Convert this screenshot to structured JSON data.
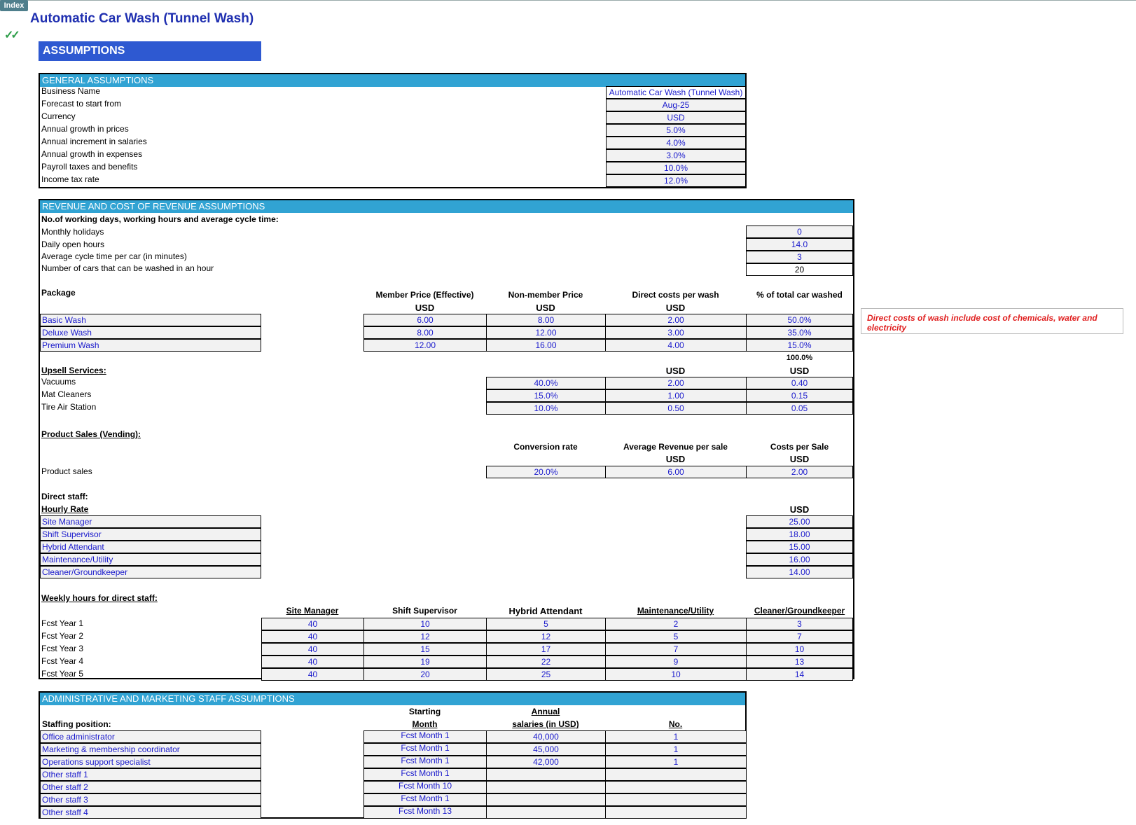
{
  "index_button": "Index",
  "title": "Automatic Car Wash (Tunnel Wash)",
  "assumptions_label": "ASSUMPTIONS",
  "general": {
    "header": "GENERAL ASSUMPTIONS",
    "rows": [
      {
        "label": "Business Name",
        "value": "Automatic Car Wash (Tunnel Wash)"
      },
      {
        "label": "Forecast to start from",
        "value": "Aug-25"
      },
      {
        "label": "Currency",
        "value": "USD"
      },
      {
        "label": "Annual growth in prices",
        "value": "5.0%"
      },
      {
        "label": "Annual increment in salaries",
        "value": "4.0%"
      },
      {
        "label": "Annual growth in expenses",
        "value": "3.0%"
      },
      {
        "label": "Payroll taxes and benefits",
        "value": "10.0%"
      },
      {
        "label": "Income tax rate",
        "value": "12.0%"
      }
    ]
  },
  "revenue": {
    "header": "REVENUE AND COST OF REVENUE ASSUMPTIONS",
    "working_title": "No.of  working days, working hours and average cycle time:",
    "working_rows": [
      {
        "label": "Monthly holidays",
        "value": "0"
      },
      {
        "label": "Daily open hours",
        "value": "14.0"
      },
      {
        "label": "Average cycle time per car (in minutes)",
        "value": "3"
      },
      {
        "label": "Number of cars that can be washed in an hour",
        "value": "20"
      }
    ],
    "package_label": "Package",
    "package_cols": [
      "Member Price (Effective)",
      "Non-member Price",
      "Direct costs per wash",
      "% of total car washed"
    ],
    "usd": "USD",
    "packages": [
      {
        "name": "Basic Wash",
        "member": "6.00",
        "nonmember": "8.00",
        "cost": "2.00",
        "pct": "50.0%"
      },
      {
        "name": "Deluxe Wash",
        "member": "8.00",
        "nonmember": "12.00",
        "cost": "3.00",
        "pct": "35.0%"
      },
      {
        "name": "Premium Wash",
        "member": "12.00",
        "nonmember": "16.00",
        "cost": "4.00",
        "pct": "15.0%"
      }
    ],
    "package_total": "100.0%",
    "note": "Direct costs of wash include cost of chemicals, water and electricity",
    "upsell_title": "Upsell Services:",
    "upsell": [
      {
        "name": "Vacuums",
        "rate": "40.0%",
        "price": "2.00",
        "cost": "0.40"
      },
      {
        "name": "Mat Cleaners",
        "rate": "15.0%",
        "price": "1.00",
        "cost": "0.15"
      },
      {
        "name": "Tire Air Station",
        "rate": "10.0%",
        "price": "0.50",
        "cost": "0.05"
      }
    ],
    "product_title": "Product Sales (Vending):",
    "product_cols": [
      "Conversion rate",
      "Average Revenue per sale",
      "Costs per Sale"
    ],
    "product": {
      "name": "Product sales",
      "rate": "20.0%",
      "revenue": "6.00",
      "cost": "2.00"
    },
    "direct_staff_title": "Direct staff:",
    "hourly_rate_title": "Hourly Rate",
    "staff_rates": [
      {
        "name": "Site Manager",
        "rate": "25.00"
      },
      {
        "name": "Shift Supervisor",
        "rate": "18.00"
      },
      {
        "name": "Hybrid Attendant",
        "rate": "15.00"
      },
      {
        "name": "Maintenance/Utility",
        "rate": "16.00"
      },
      {
        "name": "Cleaner/Groundkeeper",
        "rate": "14.00"
      }
    ],
    "weekly_title": "Weekly hours for direct staff:",
    "weekly_cols": [
      "Site Manager",
      "Shift Supervisor",
      "Hybrid Attendant",
      "Maintenance/Utility",
      "Cleaner/Groundkeeper"
    ],
    "weekly_rows": [
      {
        "label": "Fcst Year 1",
        "values": [
          "40",
          "10",
          "5",
          "2",
          "3"
        ]
      },
      {
        "label": "Fcst Year 2",
        "values": [
          "40",
          "12",
          "12",
          "5",
          "7"
        ]
      },
      {
        "label": "Fcst Year 3",
        "values": [
          "40",
          "15",
          "17",
          "7",
          "10"
        ]
      },
      {
        "label": "Fcst Year 4",
        "values": [
          "40",
          "19",
          "22",
          "9",
          "13"
        ]
      },
      {
        "label": "Fcst Year 5",
        "values": [
          "40",
          "20",
          "25",
          "10",
          "14"
        ]
      }
    ]
  },
  "admin": {
    "header": "ADMINISTRATIVE AND MARKETING STAFF ASSUMPTIONS",
    "staffing_label": "Staffing position:",
    "col_start_1": "Starting",
    "col_start_2": "Month",
    "col_sal_1": "Annual",
    "col_sal_2": "salaries (in USD)",
    "col_no": "No.",
    "rows": [
      {
        "position": "Office administrator",
        "month": "Fcst Month 1",
        "salary": "40,000",
        "no": "1"
      },
      {
        "position": "Marketing & membership coordinator",
        "month": "Fcst Month 1",
        "salary": "45,000",
        "no": "1"
      },
      {
        "position": "Operations support specialist",
        "month": "Fcst Month 1",
        "salary": "42,000",
        "no": "1"
      },
      {
        "position": "Other staff 1",
        "month": "Fcst Month 1",
        "salary": "",
        "no": ""
      },
      {
        "position": "Other staff 2",
        "month": "Fcst Month 10",
        "salary": "",
        "no": ""
      },
      {
        "position": "Other staff 3",
        "month": "Fcst Month 1",
        "salary": "",
        "no": ""
      },
      {
        "position": "Other staff 4",
        "month": "Fcst Month 13",
        "salary": "",
        "no": ""
      }
    ]
  }
}
